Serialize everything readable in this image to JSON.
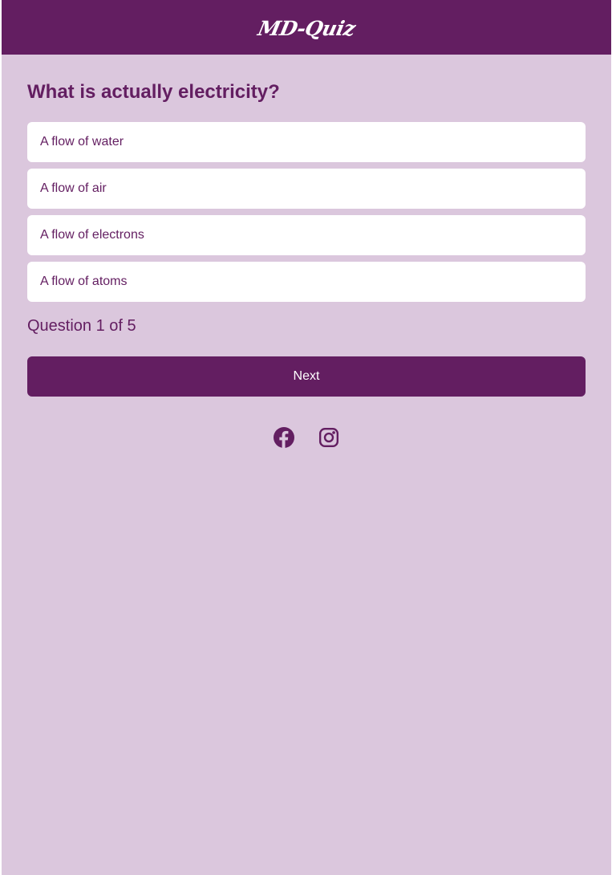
{
  "header": {
    "logo_text": "MD-Quiz"
  },
  "quiz": {
    "question": "What is actually electricity?",
    "answers": [
      {
        "label": "A flow of water"
      },
      {
        "label": "A flow of air"
      },
      {
        "label": "A flow of electrons"
      },
      {
        "label": "A flow of atoms"
      }
    ],
    "progress_text": "Question 1 of 5",
    "next_label": "Next"
  },
  "footer": {
    "social_icons": [
      "facebook-icon",
      "instagram-icon"
    ]
  },
  "colors": {
    "primary": "#631e61",
    "background": "#dbc7dd",
    "card": "#ffffff"
  }
}
